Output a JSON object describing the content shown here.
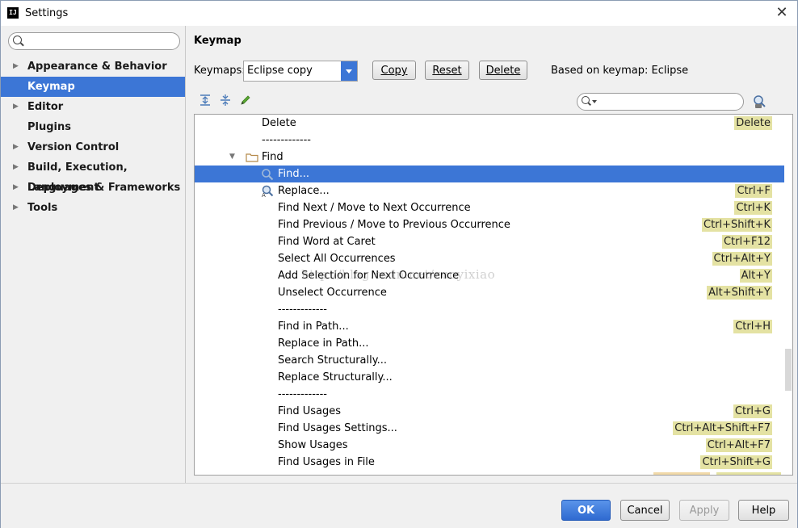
{
  "window": {
    "title": "Settings",
    "app_icon_text": "IJ",
    "close_glyph": "✕"
  },
  "sidebar": {
    "search_placeholder": "",
    "items": [
      {
        "label": "Appearance & Behavior",
        "expandable": true,
        "selected": false
      },
      {
        "label": "Keymap",
        "expandable": false,
        "selected": true
      },
      {
        "label": "Editor",
        "expandable": true,
        "selected": false
      },
      {
        "label": "Plugins",
        "expandable": false,
        "selected": false
      },
      {
        "label": "Version Control",
        "expandable": true,
        "selected": false
      },
      {
        "label": "Build, Execution, Deployment",
        "expandable": true,
        "selected": false
      },
      {
        "label": "Languages & Frameworks",
        "expandable": true,
        "selected": false
      },
      {
        "label": "Tools",
        "expandable": true,
        "selected": false
      }
    ]
  },
  "main": {
    "title": "Keymap",
    "keymaps_label": "Keymaps:",
    "keymap_value": "Eclipse copy",
    "copy_button": "Copy",
    "reset_button": "Reset",
    "delete_button": "Delete",
    "based_on": "Based on keymap: Eclipse",
    "filter_placeholder": ""
  },
  "tree": {
    "rows": [
      {
        "text": "Delete",
        "shortcut": "Delete",
        "indent": 1,
        "icon": null,
        "selected": false
      },
      {
        "text": "-------------",
        "shortcut": null,
        "indent": 1,
        "icon": null,
        "selected": false
      },
      {
        "text": "Find",
        "shortcut": null,
        "indent": 0,
        "icon": "folder-icon",
        "expanded": true,
        "selected": false
      },
      {
        "text": "Find...",
        "shortcut": null,
        "indent": 2,
        "icon": "search-icon",
        "selected": true
      },
      {
        "text": "Replace...",
        "shortcut": "Ctrl+F",
        "indent": 2,
        "icon": "replace-icon",
        "selected": false
      },
      {
        "text": "Find Next / Move to Next Occurrence",
        "shortcut": "Ctrl+K",
        "indent": 2,
        "icon": null,
        "selected": false
      },
      {
        "text": "Find Previous / Move to Previous Occurrence",
        "shortcut": "Ctrl+Shift+K",
        "indent": 2,
        "icon": null,
        "selected": false
      },
      {
        "text": "Find Word at Caret",
        "shortcut": "Ctrl+F12",
        "indent": 2,
        "icon": null,
        "selected": false
      },
      {
        "text": "Select All Occurrences",
        "shortcut": "Ctrl+Alt+Y",
        "indent": 2,
        "icon": null,
        "selected": false
      },
      {
        "text": "Add Selection for Next Occurrence",
        "shortcut": "Alt+Y",
        "indent": 2,
        "icon": null,
        "selected": false
      },
      {
        "text": "Unselect Occurrence",
        "shortcut": "Alt+Shift+Y",
        "indent": 2,
        "icon": null,
        "selected": false
      },
      {
        "text": "-------------",
        "shortcut": null,
        "indent": 2,
        "icon": null,
        "selected": false
      },
      {
        "text": "Find in Path...",
        "shortcut": "Ctrl+H",
        "indent": 2,
        "icon": null,
        "selected": false
      },
      {
        "text": "Replace in Path...",
        "shortcut": null,
        "indent": 2,
        "icon": null,
        "selected": false
      },
      {
        "text": "Search Structurally...",
        "shortcut": null,
        "indent": 2,
        "icon": null,
        "selected": false
      },
      {
        "text": "Replace Structurally...",
        "shortcut": null,
        "indent": 2,
        "icon": null,
        "selected": false
      },
      {
        "text": "-------------",
        "shortcut": null,
        "indent": 2,
        "icon": null,
        "selected": false
      },
      {
        "text": "Find Usages",
        "shortcut": "Ctrl+G",
        "indent": 2,
        "icon": null,
        "selected": false
      },
      {
        "text": "Find Usages Settings...",
        "shortcut": "Ctrl+Alt+Shift+F7",
        "indent": 2,
        "icon": null,
        "selected": false
      },
      {
        "text": "Show Usages",
        "shortcut": "Ctrl+Alt+F7",
        "indent": 2,
        "icon": null,
        "selected": false
      },
      {
        "text": "Find Usages in File",
        "shortcut": "Ctrl+Shift+G",
        "indent": 2,
        "icon": null,
        "selected": false
      }
    ]
  },
  "watermark": "http://blog.csdn.net/zuoyixiao",
  "footer": {
    "ok": "OK",
    "cancel": "Cancel",
    "apply": "Apply",
    "help": "Help"
  },
  "colors": {
    "selection": "#3c76d6",
    "shortcut_badge": "#e4e2a3",
    "ok_button": "#3c76d6"
  }
}
